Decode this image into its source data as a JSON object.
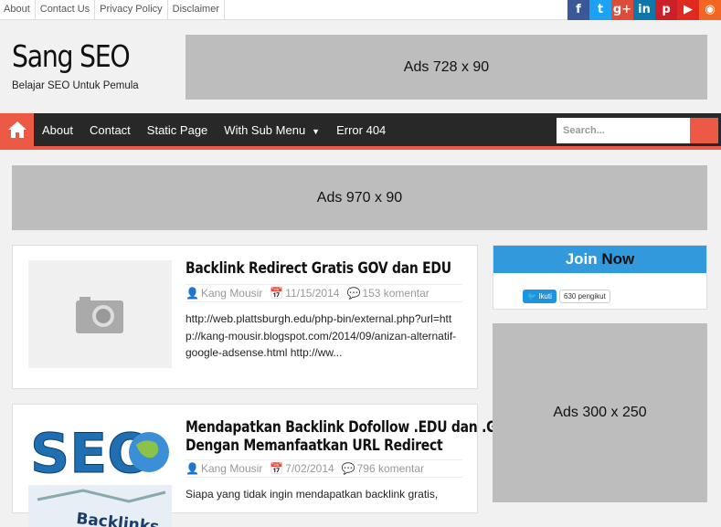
{
  "topbar": {
    "links": [
      "About",
      "Contact Us",
      "Privacy Policy",
      "Disclaimer"
    ],
    "social": [
      {
        "name": "facebook-icon",
        "glyph": "f",
        "color": "#3b5998"
      },
      {
        "name": "twitter-icon",
        "glyph": "t",
        "color": "#1da1f2"
      },
      {
        "name": "google-plus-icon",
        "glyph": "g+",
        "color": "#dd4b39"
      },
      {
        "name": "linkedin-icon",
        "glyph": "in",
        "color": "#0e76a8"
      },
      {
        "name": "pinterest-icon",
        "glyph": "p",
        "color": "#cb2027"
      },
      {
        "name": "youtube-icon",
        "glyph": "▶",
        "color": "#e02a20"
      },
      {
        "name": "rss-icon",
        "glyph": "◉",
        "color": "#f26522"
      }
    ]
  },
  "header": {
    "title": "Sang SEO",
    "description": "Belajar SEO Untuk Pemula",
    "ad": "Ads 728 x 90"
  },
  "nav": {
    "items": [
      "About",
      "Contact",
      "Static Page",
      "With Sub Menu",
      "Error 404"
    ],
    "search_placeholder": "Search...",
    "accent": "#ec5a45"
  },
  "banner_ad": "Ads 970 x 90",
  "posts": [
    {
      "title": "Backlink Redirect Gratis GOV dan EDU",
      "author": "Kang Mousir",
      "date": "11/15/2014",
      "comments": "153 komentar",
      "excerpt": "http://web.plattsburgh.edu/php-bin/external.php?url=http://kang-mousir.blogspot.com/2014/09/anizan-alternatif-google-adsense.html http://ww..."
    },
    {
      "title_line1": "Mendapatkan Backlink Dofollow .EDU dan .GOV",
      "title_line2": "Dengan Memanfaatkan URL Redirect",
      "author": "Kang Mousir",
      "date": "7/02/2014",
      "comments": "796 komentar",
      "excerpt": "Siapa yang tidak ingin mendapatkan backlink gratis,",
      "thumb_text": "SEO",
      "thumb_sub": "Backlinks"
    }
  ],
  "sidebar": {
    "join_word": "Join",
    "now_word": "Now",
    "follow_label": "Ikuti",
    "follow_count": "630 pengikut",
    "ad": "Ads 300 x 250"
  }
}
